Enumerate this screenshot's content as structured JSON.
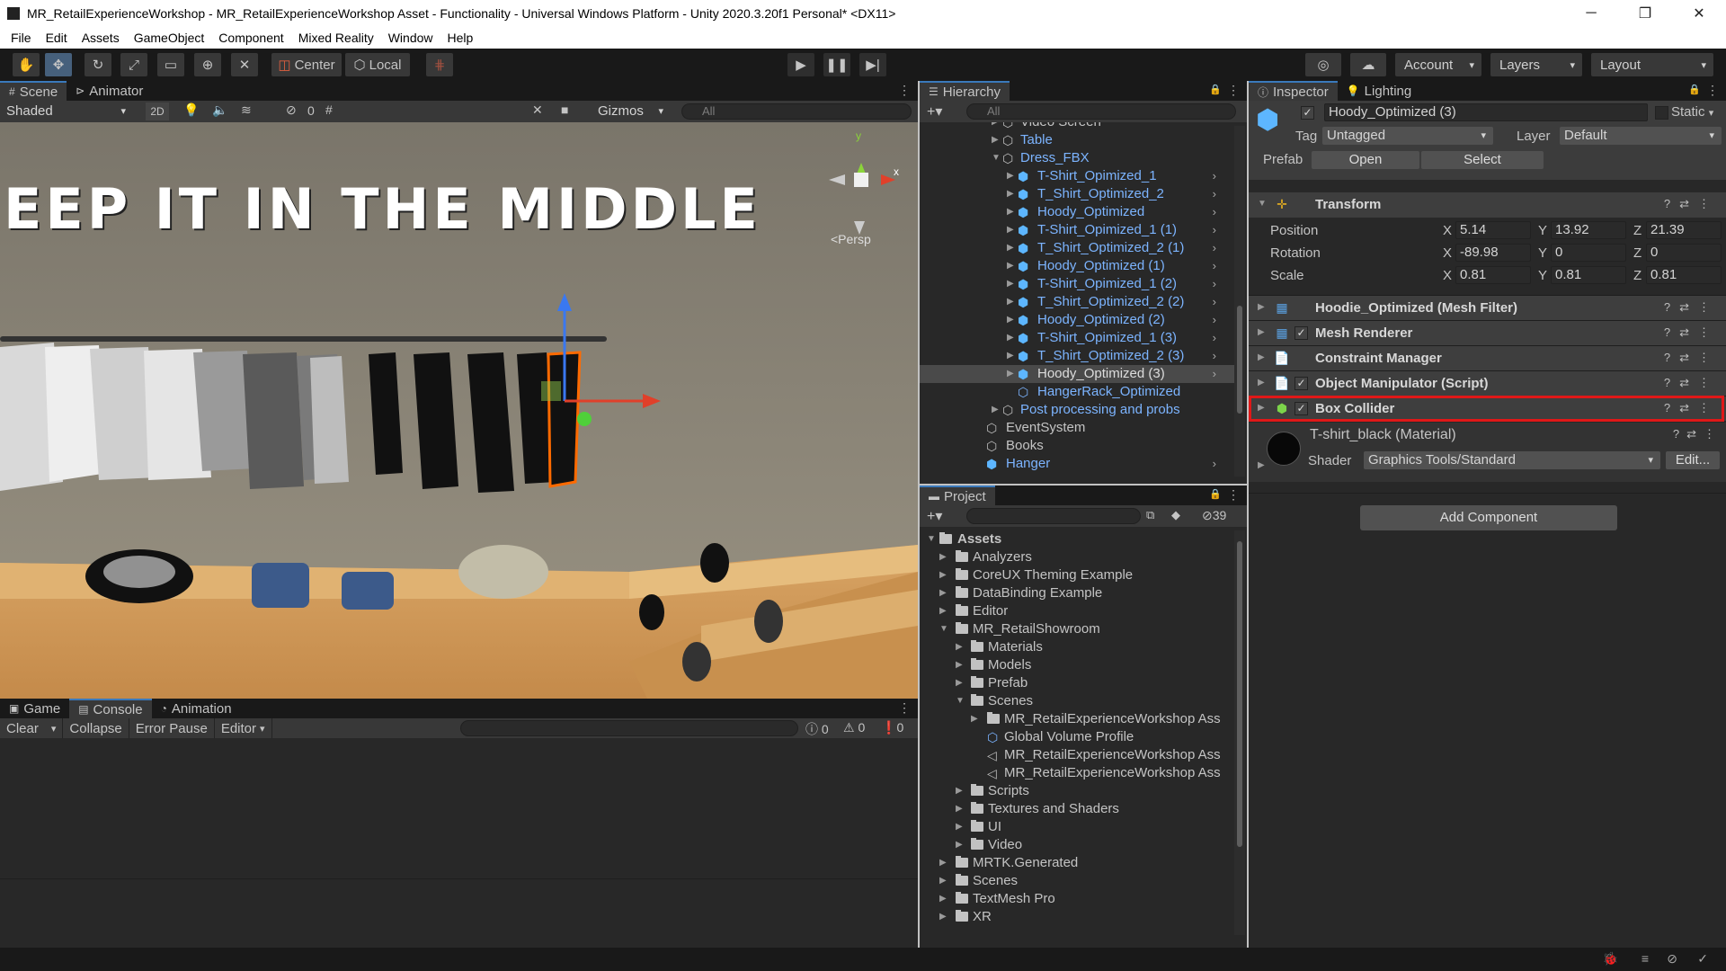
{
  "window": {
    "title": "MR_RetailExperienceWorkshop - MR_RetailExperienceWorkshop Asset - Functionality - Universal Windows Platform - Unity 2020.3.20f1 Personal* <DX11>",
    "minimize": "─",
    "maximize": "❐",
    "close": "✕"
  },
  "menu": [
    "File",
    "Edit",
    "Assets",
    "GameObject",
    "Component",
    "Mixed Reality",
    "Window",
    "Help"
  ],
  "toolbar": {
    "center_label": "Center",
    "local_label": "Local",
    "account_label": "Account",
    "layers_label": "Layers",
    "layout_label": "Layout"
  },
  "scene": {
    "tabs": [
      "Scene",
      "Animator"
    ],
    "shading": "Shaded",
    "mode_2d": "2D",
    "hidden_count": "0",
    "gizmos": "Gizmos",
    "search_placeholder": "All",
    "wall_text": "EEP IT IN THE MIDDLE",
    "persp": "<Persp",
    "axis_y": "y",
    "axis_x": "x"
  },
  "console": {
    "tabs": [
      "Game",
      "Console",
      "Animation"
    ],
    "buttons": [
      "Clear",
      "Collapse",
      "Error Pause",
      "Editor"
    ],
    "count_info": "0",
    "count_warn": "0",
    "count_err": "0"
  },
  "hierarchy": {
    "tab": "Hierarchy",
    "search_placeholder": "All",
    "items": [
      {
        "label": "Video Screen"
      },
      {
        "label": "Table"
      },
      {
        "label": "Dress_FBX"
      },
      {
        "label": "T-Shirt_Opimized_1"
      },
      {
        "label": "T_Shirt_Optimized_2"
      },
      {
        "label": "Hoody_Optimized"
      },
      {
        "label": "T-Shirt_Opimized_1 (1)"
      },
      {
        "label": "T_Shirt_Optimized_2 (1)"
      },
      {
        "label": "Hoody_Optimized (1)"
      },
      {
        "label": "T-Shirt_Opimized_1 (2)"
      },
      {
        "label": "T_Shirt_Optimized_2 (2)"
      },
      {
        "label": "Hoody_Optimized (2)"
      },
      {
        "label": "T-Shirt_Opimized_1 (3)"
      },
      {
        "label": "T_Shirt_Optimized_2 (3)"
      },
      {
        "label": "Hoody_Optimized (3)"
      },
      {
        "label": "HangerRack_Optimized"
      },
      {
        "label": "Post processing and probs"
      },
      {
        "label": "EventSystem"
      },
      {
        "label": "Books"
      },
      {
        "label": "Hanger"
      }
    ]
  },
  "project": {
    "tab": "Project",
    "hidden_count": "39",
    "items": [
      {
        "label": "Assets"
      },
      {
        "label": "Analyzers"
      },
      {
        "label": "CoreUX Theming Example"
      },
      {
        "label": "DataBinding Example"
      },
      {
        "label": "Editor"
      },
      {
        "label": "MR_RetailShowroom"
      },
      {
        "label": "Materials"
      },
      {
        "label": "Models"
      },
      {
        "label": "Prefab"
      },
      {
        "label": "Scenes"
      },
      {
        "label": "MR_RetailExperienceWorkshop Ass"
      },
      {
        "label": "Global Volume Profile"
      },
      {
        "label": "MR_RetailExperienceWorkshop Ass"
      },
      {
        "label": "MR_RetailExperienceWorkshop Ass"
      },
      {
        "label": "Scripts"
      },
      {
        "label": "Textures and Shaders"
      },
      {
        "label": "UI"
      },
      {
        "label": "Video"
      },
      {
        "label": "MRTK.Generated"
      },
      {
        "label": "Scenes"
      },
      {
        "label": "TextMesh Pro"
      },
      {
        "label": "XR"
      }
    ]
  },
  "inspector": {
    "tabs": [
      "Inspector",
      "Lighting"
    ],
    "object_name": "Hoody_Optimized (3)",
    "static_label": "Static",
    "tag_label": "Tag",
    "tag_value": "Untagged",
    "layer_label": "Layer",
    "layer_value": "Default",
    "prefab_label": "Prefab",
    "open_label": "Open",
    "select_label": "Select",
    "transform": {
      "title": "Transform",
      "position_label": "Position",
      "px": "5.14",
      "py": "13.92",
      "pz": "21.39",
      "rotation_label": "Rotation",
      "rx": "-89.98",
      "ry": "0",
      "rz": "0",
      "scale_label": "Scale",
      "sx": "0.81",
      "sy": "0.81",
      "sz": "0.81",
      "x": "X",
      "y": "Y",
      "z": "Z"
    },
    "components": [
      "Hoodie_Optimized (Mesh Filter)",
      "Mesh Renderer",
      "Constraint Manager",
      "Object Manipulator (Script)",
      "Box Collider"
    ],
    "material": {
      "name": "T-shirt_black (Material)",
      "shader_label": "Shader",
      "shader_value": "Graphics Tools/Standard",
      "edit_label": "Edit..."
    },
    "add_component": "Add Component"
  },
  "colors": {
    "accent_blue": "#3a79bb",
    "prefab_blue": "#7cb4ff",
    "highlight_red": "#e01818"
  }
}
